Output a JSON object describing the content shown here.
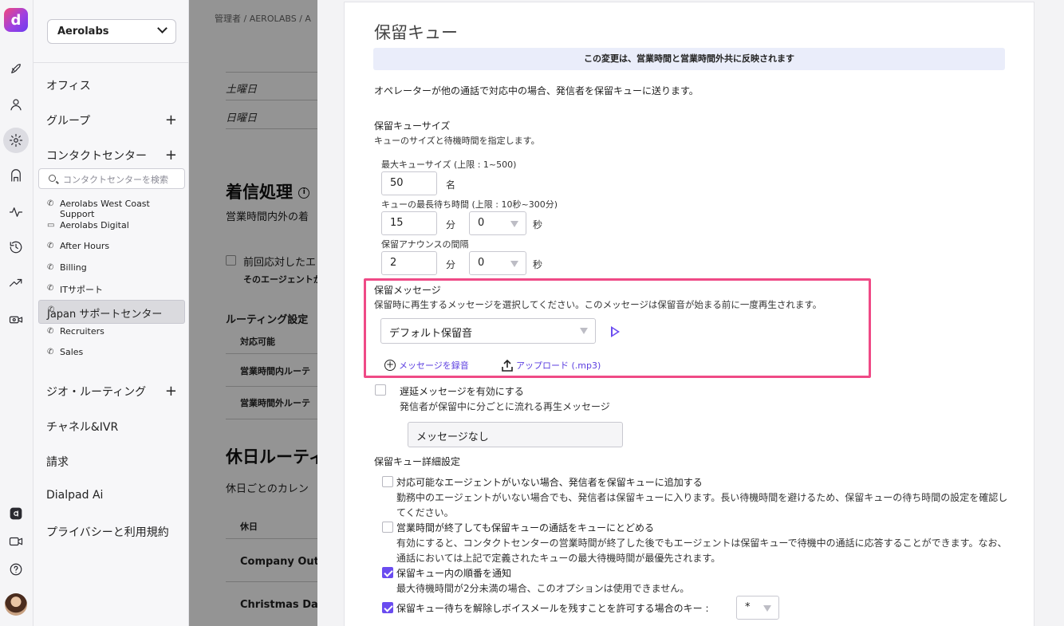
{
  "rail": {
    "logo": "d",
    "icons": [
      "rocket-icon",
      "person-icon",
      "gear-icon",
      "contact-center-icon",
      "activity-icon",
      "history-icon",
      "trend-icon",
      "video-settings-icon",
      "dialpad-ai-icon",
      "video-icon",
      "help-icon"
    ]
  },
  "nav": {
    "org": "Aerolabs",
    "office": "オフィス",
    "group": "グループ",
    "contact_center": "コンタクトセンター",
    "cc_search_placeholder": "コンタクトセンターを検索",
    "cc_items": [
      {
        "label": "Aerolabs West Coast Support",
        "icon": "phone-icon"
      },
      {
        "label": "Aerolabs Digital",
        "icon": "monitor-icon"
      },
      {
        "label": "After Hours",
        "icon": "phone-icon"
      },
      {
        "label": "Billing",
        "icon": "phone-icon"
      },
      {
        "label": "ITサポート",
        "icon": "phone-icon"
      },
      {
        "label": "Japan サポートセンター",
        "icon": "phone-icon"
      },
      {
        "label": "Recruiters",
        "icon": "phone-icon"
      },
      {
        "label": "Sales",
        "icon": "phone-icon"
      }
    ],
    "geo_routing": "ジオ・ルーティング",
    "channels_ivr": "チャネル&IVR",
    "billing": "請求",
    "dialpad_ai": "Dialpad Ai",
    "privacy": "プライバシーと利用規約"
  },
  "background": {
    "breadcrumb": "管理者 / AEROLABS / A",
    "saturday": "土曜日",
    "sunday": "日曜日",
    "incoming_title": "着信処理",
    "incoming_desc": "営業時間内外の着",
    "prev_agent": "前回応対したエ",
    "prev_agent_sub": "そのエージェントか",
    "routing_title": "ルーティング設定",
    "available": "対応可能",
    "in_hours": "営業時間内ルーテ",
    "out_hours": "営業時間外ルーテ",
    "holiday_title": "休日ルーティ",
    "holiday_desc": "休日ごとのカレン",
    "holiday_col": "休日",
    "holiday_1": "Company Outin",
    "holiday_2": "Christmas Day"
  },
  "drawer": {
    "title": "保留キュー",
    "banner": "この変更は、営業時間と営業時間外共に反映されます",
    "intro": "オペレーターが他の通話で対応中の場合、発信者を保留キューに送ります。",
    "size_title": "保留キューサイズ",
    "size_desc": "キューのサイズと待機時間を指定します。",
    "max_size_label": "最大キューサイズ (上限 : 1~500)",
    "max_size_value": "50",
    "max_size_unit": "名",
    "max_wait_label": "キューの最長待ち時間 (上限 : 10秒~300分)",
    "max_wait_min": "15",
    "max_wait_sec": "0",
    "unit_min": "分",
    "unit_sec": "秒",
    "announce_label": "保留アナウンスの間隔",
    "announce_min": "2",
    "announce_sec": "0",
    "hold_msg_title": "保留メッセージ",
    "hold_msg_desc": "保留時に再生するメッセージを選択してください。このメッセージは保留音が始まる前に一度再生されます。",
    "hold_msg_select": "デフォルト保留音",
    "record_link": "メッセージを録音",
    "upload_link": "アップロード (.mp3)",
    "delay_label": "遅延メッセージを有効にする",
    "delay_desc": "発信者が保留中に分ごとに流れる再生メッセージ",
    "delay_select": "メッセージなし",
    "advanced_title": "保留キュー詳細設定",
    "opt1_label": "対応可能なエージェントがいない場合、発信者を保留キューに追加する",
    "opt1_desc": "勤務中のエージェントがいない場合でも、発信者は保留キューに入ります。長い待機時間を避けるため、保留キューの待ち時間の設定を確認してください。",
    "opt2_label": "営業時間が終了しても保留キューの通話をキューにとどめる",
    "opt2_desc": "有効にすると、コンタクトセンターの営業時間が終了した後でもエージェントは保留キューで待機中の通話に応答することができます。なお、通話においては上記で定義されたキューの最大待機時間が最優先されます。",
    "opt3_label": "保留キュー内の順番を通知",
    "opt3_desc": "最大待機時間が2分未満の場合、このオプションは使用できません。",
    "opt4_label": "保留キュー待ちを解除しボイスメールを残すことを許可する場合のキー :",
    "opt4_key": "*",
    "checkbox_states": {
      "delay": false,
      "opt1": false,
      "opt2": false,
      "opt3": true,
      "opt4": true
    }
  },
  "colors": {
    "accent": "#6a4cf0",
    "highlight": "#ef4a86",
    "banner_bg": "#eaedfa"
  }
}
